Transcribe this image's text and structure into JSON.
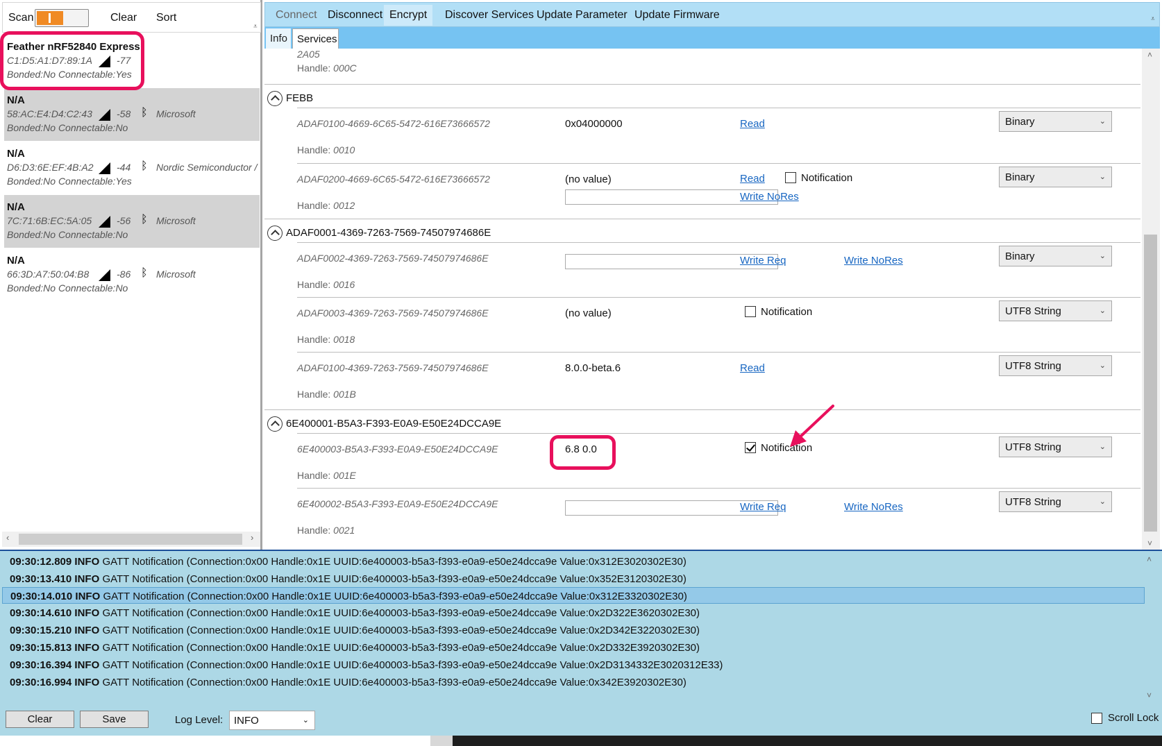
{
  "left_toolbar": {
    "scan_label": "Scan",
    "clear_label": "Clear",
    "sort_label": "Sort",
    "overflow_glyph": "⩡"
  },
  "devices": [
    {
      "name": "Feather nRF52840 Express",
      "address": "C1:D5:A1:D7:89:1A",
      "rssi": "-77",
      "vendor": "",
      "status": "Bonded:No Connectable:Yes"
    },
    {
      "name": "N/A",
      "address": "58:AC:E4:D4:C2:43",
      "rssi": "-58",
      "vendor": "Microsoft",
      "status": "Bonded:No Connectable:No"
    },
    {
      "name": "N/A",
      "address": "D6:D3:6E:EF:4B:A2",
      "rssi": "-44",
      "vendor": "Nordic Semiconductor /",
      "status": "Bonded:No Connectable:Yes"
    },
    {
      "name": "N/A",
      "address": "7C:71:6B:EC:5A:05",
      "rssi": "-56",
      "vendor": "Microsoft",
      "status": "Bonded:No Connectable:No"
    },
    {
      "name": "N/A",
      "address": "66:3D:A7:50:04:B8",
      "rssi": "-86",
      "vendor": "Microsoft",
      "status": "Bonded:No Connectable:No"
    }
  ],
  "toolbar": {
    "connect": "Connect",
    "disconnect": "Disconnect",
    "encrypt": "Encrypt",
    "discover": "Discover Services",
    "update_param": "Update Parameter",
    "update_fw": "Update Firmware"
  },
  "tabs": {
    "info": "Info",
    "services": "Services"
  },
  "top_partial": {
    "uuid": "2A05",
    "handle_label": "Handle:",
    "handle": "000C"
  },
  "services": [
    {
      "uuid": "FEBB",
      "characteristics": [
        {
          "uuid": "ADAF0100-4669-6C65-5472-616E73666572",
          "handle": "0010",
          "value": "0x04000000",
          "read": "Read",
          "format": "Binary"
        },
        {
          "uuid": "ADAF0200-4669-6C65-5472-616E73666572",
          "handle": "0012",
          "value": "(no value)",
          "read": "Read",
          "notification": "Notification",
          "write_nores": "Write NoRes",
          "format": "Binary"
        }
      ]
    },
    {
      "uuid": "ADAF0001-4369-7263-7569-74507974686E",
      "characteristics": [
        {
          "uuid": "ADAF0002-4369-7263-7569-74507974686E",
          "handle": "0016",
          "write_req": "Write Req",
          "write_nores": "Write NoRes",
          "format": "Binary"
        },
        {
          "uuid": "ADAF0003-4369-7263-7569-74507974686E",
          "handle": "0018",
          "value": "(no value)",
          "notification": "Notification",
          "format": "UTF8 String"
        },
        {
          "uuid": "ADAF0100-4369-7263-7569-74507974686E",
          "handle": "001B",
          "value": "8.0.0-beta.6",
          "read": "Read",
          "format": "UTF8 String"
        }
      ]
    },
    {
      "uuid": "6E400001-B5A3-F393-E0A9-E50E24DCCA9E",
      "characteristics": [
        {
          "uuid": "6E400003-B5A3-F393-E0A9-E50E24DCCA9E",
          "handle": "001E",
          "value": "6.8 0.0",
          "notification": "Notification",
          "notification_checked": true,
          "format": "UTF8 String"
        },
        {
          "uuid": "6E400002-B5A3-F393-E0A9-E50E24DCCA9E",
          "handle": "0021",
          "write_req": "Write Req",
          "write_nores": "Write NoRes",
          "format": "UTF8 String"
        }
      ]
    }
  ],
  "log": {
    "lines": [
      {
        "time": "09:30:12.809",
        "level": "INFO",
        "msg": "GATT Notification (Connection:0x00 Handle:0x1E UUID:6e400003-b5a3-f393-e0a9-e50e24dcca9e Value:0x312E3020302E30)"
      },
      {
        "time": "09:30:13.410",
        "level": "INFO",
        "msg": "GATT Notification (Connection:0x00 Handle:0x1E UUID:6e400003-b5a3-f393-e0a9-e50e24dcca9e Value:0x352E3120302E30)"
      },
      {
        "time": "09:30:14.010",
        "level": "INFO",
        "msg": "GATT Notification (Connection:0x00 Handle:0x1E UUID:6e400003-b5a3-f393-e0a9-e50e24dcca9e Value:0x312E3320302E30)"
      },
      {
        "time": "09:30:14.610",
        "level": "INFO",
        "msg": "GATT Notification (Connection:0x00 Handle:0x1E UUID:6e400003-b5a3-f393-e0a9-e50e24dcca9e Value:0x2D322E3620302E30)"
      },
      {
        "time": "09:30:15.210",
        "level": "INFO",
        "msg": "GATT Notification (Connection:0x00 Handle:0x1E UUID:6e400003-b5a3-f393-e0a9-e50e24dcca9e Value:0x2D342E3220302E30)"
      },
      {
        "time": "09:30:15.813",
        "level": "INFO",
        "msg": "GATT Notification (Connection:0x00 Handle:0x1E UUID:6e400003-b5a3-f393-e0a9-e50e24dcca9e Value:0x2D332E3920302E30)"
      },
      {
        "time": "09:30:16.394",
        "level": "INFO",
        "msg": "GATT Notification (Connection:0x00 Handle:0x1E UUID:6e400003-b5a3-f393-e0a9-e50e24dcca9e Value:0x2D3134332E3020312E33)"
      },
      {
        "time": "09:30:16.994",
        "level": "INFO",
        "msg": "GATT Notification (Connection:0x00 Handle:0x1E UUID:6e400003-b5a3-f393-e0a9-e50e24dcca9e Value:0x342E3920302E30)"
      }
    ],
    "clear_label": "Clear",
    "save_label": "Save",
    "log_level_label": "Log Level:",
    "log_level_value": "INFO",
    "scroll_lock_label": "Scroll Lock"
  },
  "colors": {
    "highlight": "#e8105c",
    "toolbar": "#b2dff6",
    "tabstrip": "#76c3f2",
    "log_bg": "#add8e6",
    "toggle_on": "#f08a24",
    "link": "#1766c2"
  }
}
